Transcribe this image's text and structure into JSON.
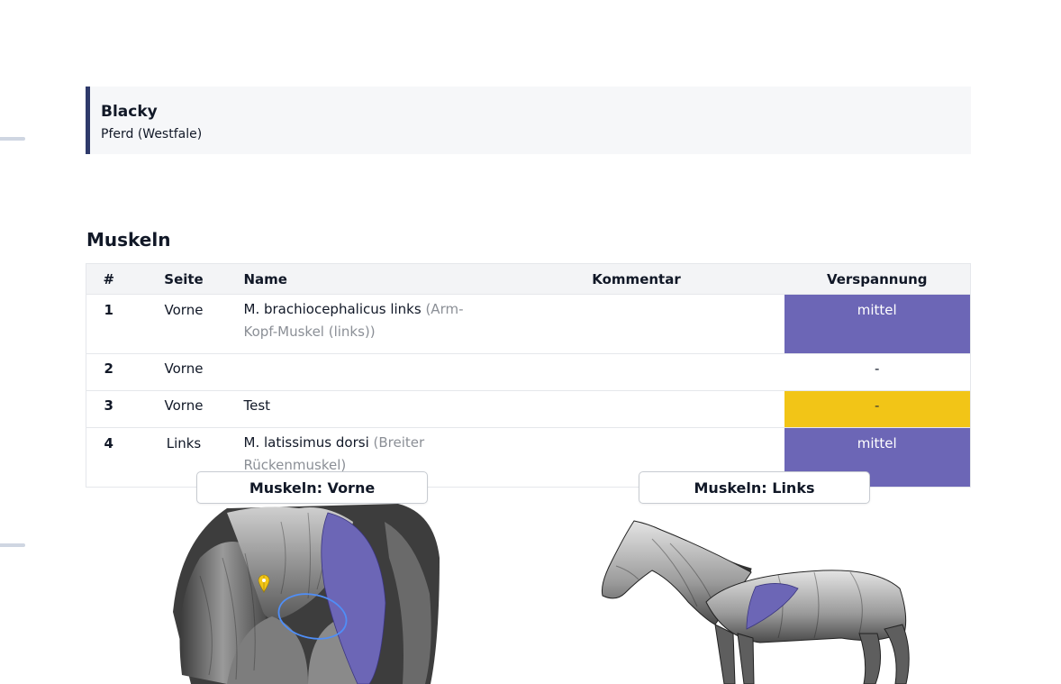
{
  "animal": {
    "name": "Blacky",
    "species_breed": "Pferd (Westfale)"
  },
  "section_title": "Muskeln",
  "table": {
    "headers": {
      "num": "#",
      "side": "Seite",
      "name": "Name",
      "comment": "Kommentar",
      "tension": "Verspannung"
    },
    "rows": [
      {
        "num": "1",
        "side": "Vorne",
        "latin": "M. brachiocephalicus links",
        "common": "(Arm-Kopf-Muskel (links))",
        "comment": "",
        "tension": "mittel",
        "tension_color": "#6c66b6"
      },
      {
        "num": "2",
        "side": "Vorne",
        "latin": "",
        "common": "",
        "comment": "",
        "tension": "-",
        "tension_color": "#ffffff"
      },
      {
        "num": "3",
        "side": "Vorne",
        "latin": "Test",
        "common": "",
        "comment": "",
        "tension": "-",
        "tension_color": "#f2c517"
      },
      {
        "num": "4",
        "side": "Links",
        "latin": "M. latissimus dorsi",
        "common": "(Breiter Rückenmuskel)",
        "comment": "",
        "tension": "mittel",
        "tension_color": "#6c66b6"
      }
    ]
  },
  "diagrams": {
    "front": {
      "label": "Muskeln: Vorne",
      "highlight_color": "#6c66b6",
      "marker_color": "#f2c517"
    },
    "side": {
      "label": "Muskeln: Links",
      "highlight_color": "#6c66b6"
    }
  }
}
